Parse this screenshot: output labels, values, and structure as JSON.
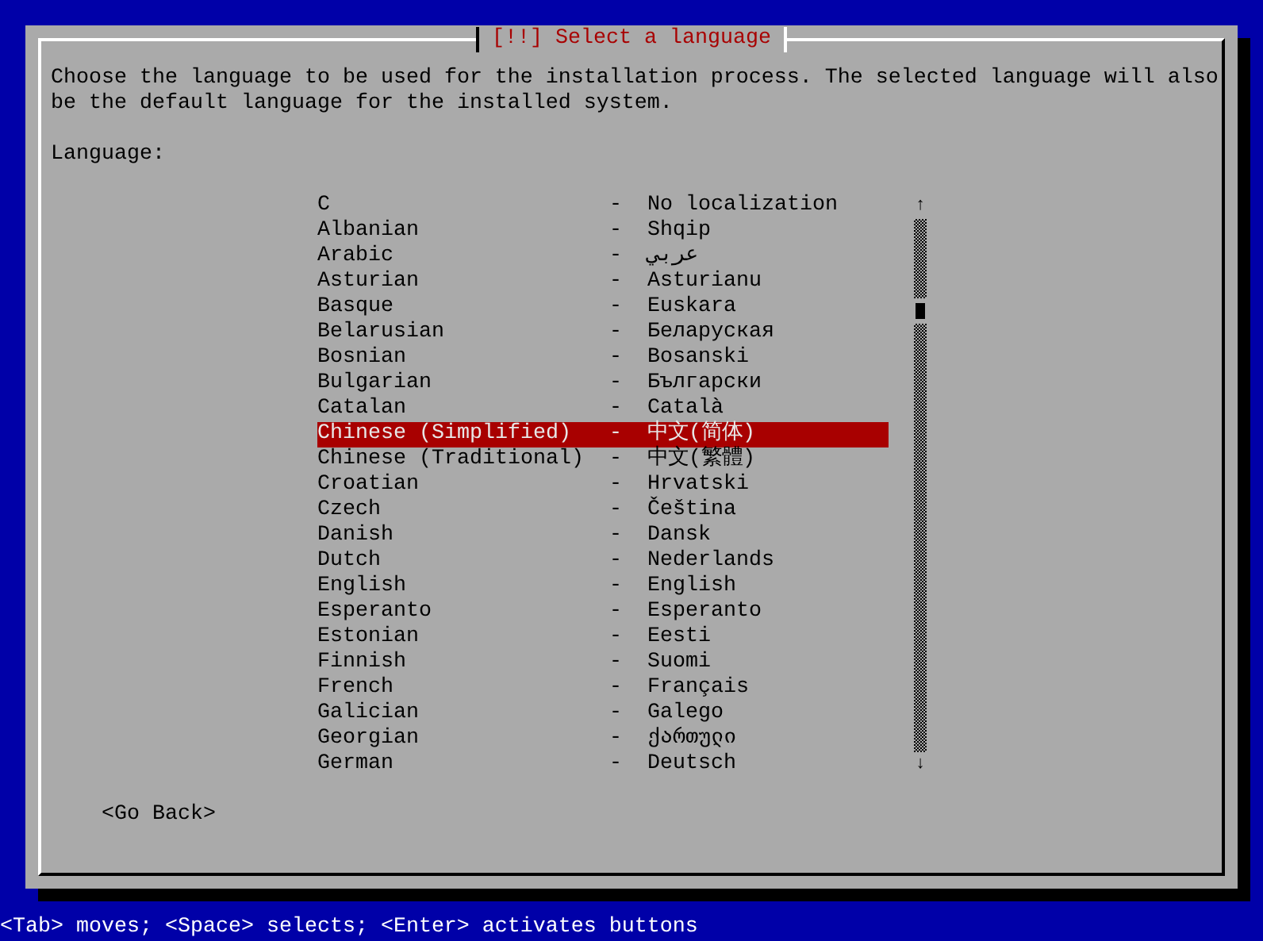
{
  "dialog": {
    "title": "[!!] Select a language",
    "description": "Choose the language to be used for the installation process. The selected language will also be the default language for the installed system.",
    "list_label": "Language:"
  },
  "languages": [
    {
      "name": "C",
      "separator": "-",
      "native": "No localization",
      "selected": false
    },
    {
      "name": "Albanian",
      "separator": "-",
      "native": "Shqip",
      "selected": false
    },
    {
      "name": "Arabic",
      "separator": "-",
      "native": "عربي",
      "selected": false
    },
    {
      "name": "Asturian",
      "separator": "-",
      "native": "Asturianu",
      "selected": false
    },
    {
      "name": "Basque",
      "separator": "-",
      "native": "Euskara",
      "selected": false
    },
    {
      "name": "Belarusian",
      "separator": "-",
      "native": "Беларуская",
      "selected": false
    },
    {
      "name": "Bosnian",
      "separator": "-",
      "native": "Bosanski",
      "selected": false
    },
    {
      "name": "Bulgarian",
      "separator": "-",
      "native": "Български",
      "selected": false
    },
    {
      "name": "Catalan",
      "separator": "-",
      "native": "Català",
      "selected": false
    },
    {
      "name": "Chinese (Simplified)",
      "separator": "-",
      "native": "中文(简体)",
      "selected": true
    },
    {
      "name": "Chinese (Traditional)",
      "separator": "-",
      "native": "中文(繁體)",
      "selected": false
    },
    {
      "name": "Croatian",
      "separator": "-",
      "native": "Hrvatski",
      "selected": false
    },
    {
      "name": "Czech",
      "separator": "-",
      "native": "Čeština",
      "selected": false
    },
    {
      "name": "Danish",
      "separator": "-",
      "native": "Dansk",
      "selected": false
    },
    {
      "name": "Dutch",
      "separator": "-",
      "native": "Nederlands",
      "selected": false
    },
    {
      "name": "English",
      "separator": "-",
      "native": "English",
      "selected": false
    },
    {
      "name": "Esperanto",
      "separator": "-",
      "native": "Esperanto",
      "selected": false
    },
    {
      "name": "Estonian",
      "separator": "-",
      "native": "Eesti",
      "selected": false
    },
    {
      "name": "Finnish",
      "separator": "-",
      "native": "Suomi",
      "selected": false
    },
    {
      "name": "French",
      "separator": "-",
      "native": "Français",
      "selected": false
    },
    {
      "name": "Galician",
      "separator": "-",
      "native": "Galego",
      "selected": false
    },
    {
      "name": "Georgian",
      "separator": "-",
      "native": "ქართული",
      "selected": false
    },
    {
      "name": "German",
      "separator": "-",
      "native": "Deutsch",
      "selected": false
    }
  ],
  "scrollbar": {
    "up": "↑",
    "down": "↓"
  },
  "buttons": [
    {
      "label": "<Go Back>"
    }
  ],
  "status_bar": "<Tab> moves; <Space> selects; <Enter> activates buttons"
}
